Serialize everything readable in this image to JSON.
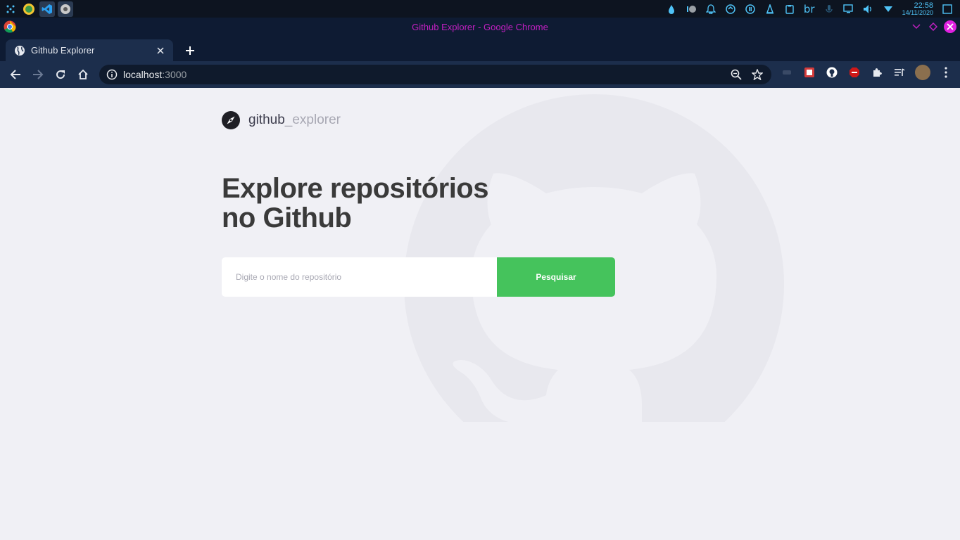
{
  "taskbar": {
    "apps": [
      {
        "name": "launcher-icon"
      },
      {
        "name": "app-a-icon"
      },
      {
        "name": "vscode-icon"
      },
      {
        "name": "chrome-app-icon"
      }
    ],
    "language": "br",
    "clock": {
      "time": "22:58",
      "date": "14/11/2020"
    },
    "colors": {
      "accent": "#4fc3f7",
      "background": "#0d1420"
    }
  },
  "window": {
    "title": "Github Explorer - Google Chrome",
    "title_color": "#c020c0"
  },
  "browser": {
    "tab": {
      "title": "Github Explorer"
    },
    "url": {
      "host": "localhost",
      "port": ":3000"
    },
    "colors": {
      "frame": "#0e1b33",
      "toolbar": "#1c2e4c",
      "omnibox": "#0f1a2c"
    }
  },
  "app": {
    "logo": {
      "main": "github",
      "sub": "_explorer"
    },
    "headline_line1": "Explore repositórios",
    "headline_line2": "no Github",
    "search": {
      "placeholder": "Digite o nome do repositório",
      "value": "",
      "button_label": "Pesquisar"
    },
    "colors": {
      "background": "#f0f0f5",
      "button": "#45c35c",
      "heading": "#3a3a3a",
      "muted": "#a8a8b3"
    }
  }
}
